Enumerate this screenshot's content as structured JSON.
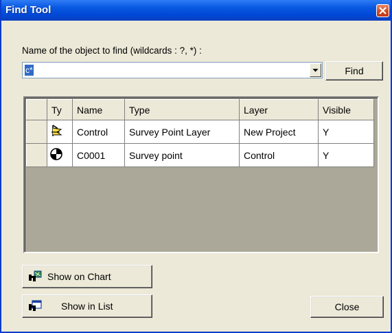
{
  "window": {
    "title": "Find Tool"
  },
  "search": {
    "label": "Name of the object to find (wildcards : ?, *) :",
    "value": "c*",
    "find_button": "Find"
  },
  "results": {
    "columns": [
      "Ty",
      "Name",
      "Type",
      "Layer",
      "Visible"
    ],
    "rows": [
      {
        "icon": "survey-layer-icon",
        "name": "Control",
        "type": "Survey Point Layer",
        "layer": "New Project",
        "visible": "Y"
      },
      {
        "icon": "survey-point-icon",
        "name": "C0001",
        "type": "Survey point",
        "layer": "Control",
        "visible": "Y"
      }
    ]
  },
  "buttons": {
    "show_on_chart": "Show on Chart",
    "show_in_list": "Show in List",
    "close": "Close"
  },
  "colors": {
    "titlebar": "#0054e3",
    "face": "#ece9d8",
    "grid_empty": "#aca899",
    "selection": "#316ac5"
  }
}
